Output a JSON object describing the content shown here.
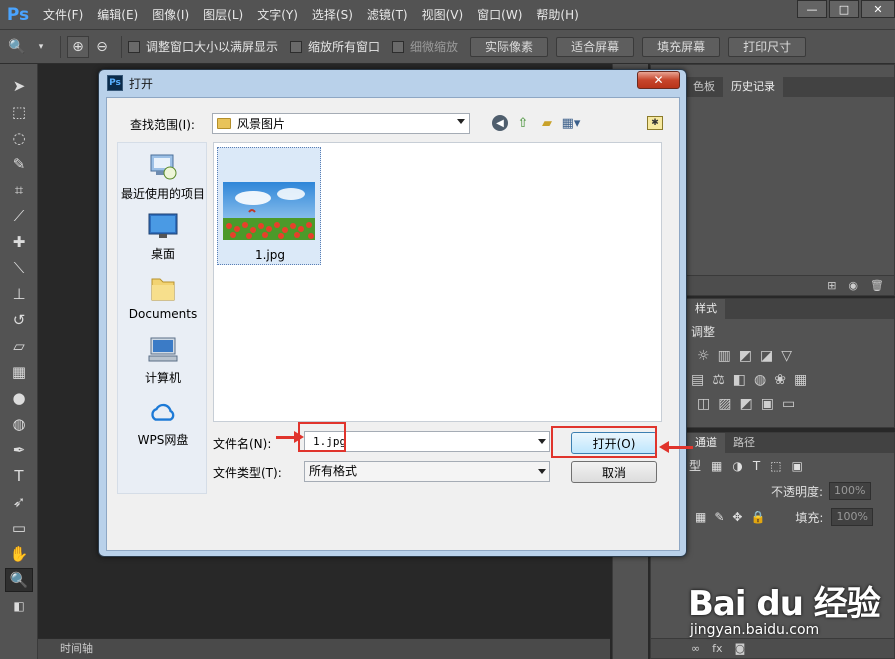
{
  "app": {
    "logo": "Ps",
    "menu": [
      "文件(F)",
      "编辑(E)",
      "图像(I)",
      "图层(L)",
      "文字(Y)",
      "选择(S)",
      "滤镜(T)",
      "视图(V)",
      "窗口(W)",
      "帮助(H)"
    ],
    "window_buttons": [
      "—",
      "□",
      "✕"
    ]
  },
  "options": {
    "checks": [
      "调整窗口大小以满屏显示",
      "缩放所有窗口",
      "细微缩放"
    ],
    "buttons": [
      "实际像素",
      "适合屏幕",
      "填充屏幕",
      "打印尺寸"
    ]
  },
  "timeline": {
    "label": "时间轴"
  },
  "panels": {
    "top_tabs": [
      "色板",
      "历史记录"
    ],
    "styles_tab": "样式",
    "adjust_title": "调整",
    "layers_tabs": [
      "通道",
      "路径"
    ],
    "layers_kind": "型",
    "opacity_label": "不透明度:",
    "opacity_value": "100%",
    "fill_label": "填充:",
    "fill_value": "100%",
    "fx_label": "fx"
  },
  "dialog": {
    "title": "打开",
    "close_glyph": "✕",
    "lookin_label": "查找范围(I):",
    "lookin_value": "风景图片",
    "places": [
      {
        "label": "最近使用的项目",
        "icon": "recent-items-icon"
      },
      {
        "label": "桌面",
        "icon": "desktop-icon"
      },
      {
        "label": "Documents",
        "icon": "documents-folder-icon"
      },
      {
        "label": "计算机",
        "icon": "computer-icon"
      },
      {
        "label": "WPS网盘",
        "icon": "cloud-icon"
      }
    ],
    "files": [
      {
        "name": "1.jpg"
      }
    ],
    "filename_label": "文件名(N):",
    "filename_value": "1.jpg",
    "filetype_label": "文件类型(T):",
    "filetype_value": "所有格式",
    "open_button": "打开(O)",
    "cancel_button": "取消"
  },
  "watermark": {
    "brand": "Bai du 经验",
    "url": "jingyan.baidu.com"
  },
  "colors": {
    "ps_blue": "#4aa4ff",
    "highlight_red": "#e0342c",
    "dialog_frame": "#b9d1ea"
  }
}
